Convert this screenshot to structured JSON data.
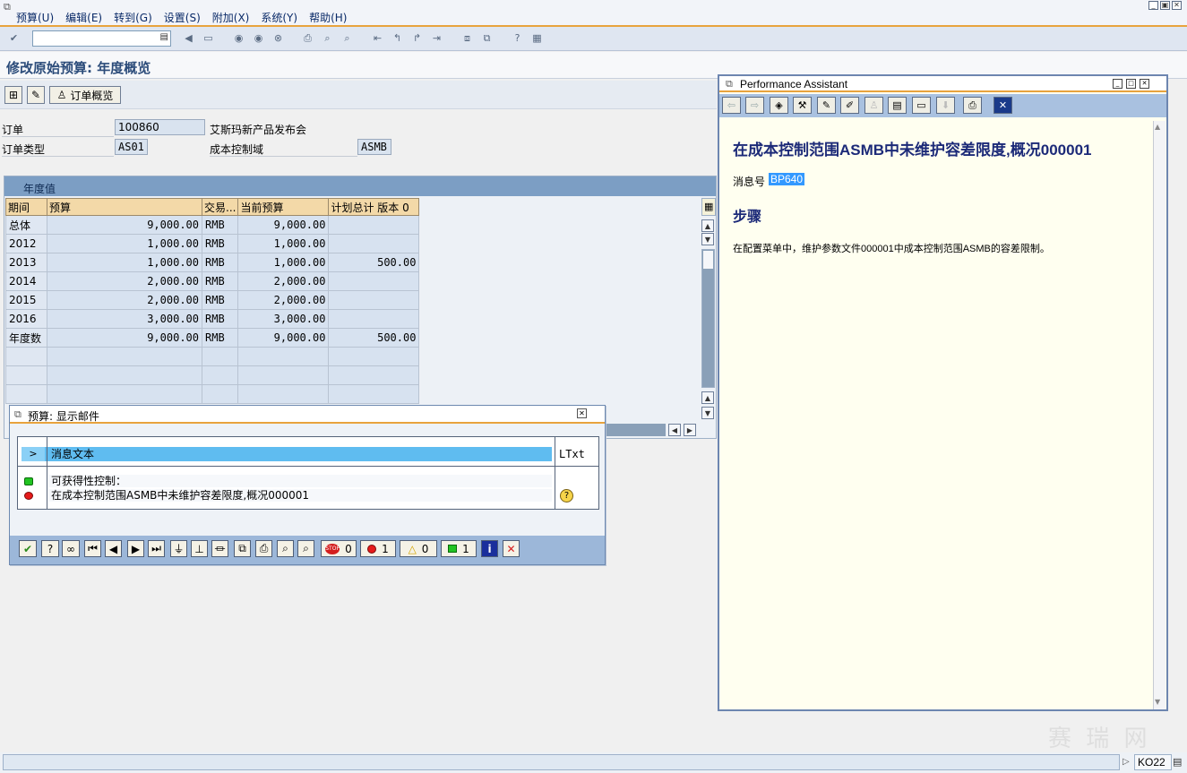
{
  "menu": {
    "items": [
      "预算(U)",
      "编辑(E)",
      "转到(G)",
      "设置(S)",
      "附加(X)",
      "系统(Y)",
      "帮助(H)"
    ]
  },
  "toolbar": {
    "command_value": "",
    "icons": [
      "enter-icon",
      "dropdown-icon",
      "back-icon",
      "save-icon",
      "back-nav-icon",
      "exit-icon",
      "cancel-icon",
      "print-icon",
      "find-icon",
      "find-next-icon",
      "first-page-icon",
      "prev-page-icon",
      "next-page-icon",
      "last-page-icon",
      "new-session-icon",
      "shortcut-icon",
      "help-icon",
      "layout-icon"
    ]
  },
  "page": {
    "title": "修改原始预算: 年度概览"
  },
  "app_toolbar": {
    "order_overview_label": "订单概览"
  },
  "header": {
    "order_label": "订单",
    "order_value": "100860",
    "order_desc": "艾斯玛新产品发布会",
    "order_type_label": "订单类型",
    "order_type_value": "AS01",
    "controlling_area_label": "成本控制域",
    "controlling_area_value": "ASMB"
  },
  "annual_table": {
    "title": "年度值",
    "columns": [
      "期间",
      "预算",
      "交易...",
      "当前预算",
      "计划总计 版本 0"
    ],
    "rows": [
      [
        "总体",
        "9,000.00",
        "RMB",
        "9,000.00",
        ""
      ],
      [
        "2012",
        "1,000.00",
        "RMB",
        "1,000.00",
        ""
      ],
      [
        "2013",
        "1,000.00",
        "RMB",
        "1,000.00",
        "500.00"
      ],
      [
        "2014",
        "2,000.00",
        "RMB",
        "2,000.00",
        ""
      ],
      [
        "2015",
        "2,000.00",
        "RMB",
        "2,000.00",
        ""
      ],
      [
        "2016",
        "3,000.00",
        "RMB",
        "3,000.00",
        ""
      ],
      [
        "年度数",
        "9,000.00",
        "RMB",
        "9,000.00",
        "500.00"
      ],
      [
        "",
        "",
        "",
        "",
        ""
      ],
      [
        "",
        "",
        "",
        "",
        ""
      ],
      [
        "",
        "",
        "",
        "",
        ""
      ]
    ]
  },
  "message_dialog": {
    "title": "预算: 显示邮件",
    "col_text": "消息文本",
    "col_ltxt": "LTxt",
    "header_marker": ">",
    "messages": [
      {
        "status": "green",
        "text": "可获得性控制："
      },
      {
        "status": "red",
        "text": "在成本控制范围ASMB中未维护容差限度,概况000001"
      }
    ],
    "counts": {
      "stop": "0",
      "error": "1",
      "warning": "0",
      "success": "1"
    },
    "colors": {
      "header": "#5fbcf0",
      "toolbar": "#9cb7d9"
    }
  },
  "performance_assistant": {
    "title": "Performance Assistant",
    "heading": "在成本控制范围ASMB中未维护容差限度,概况000001",
    "message_no_label": "消息号",
    "message_no_value": "BP640",
    "steps_heading": "步骤",
    "step_text": "在配置菜单中，维护参数文件000001中成本控制范围ASMB的容差限制。"
  },
  "status_bar": {
    "transaction": "KO22"
  },
  "watermark": "赛 瑞 网",
  "colors": {
    "accent": "#e8a33d",
    "title_text": "#2c4c7a",
    "pa_heading": "#1c2a78",
    "selection": "#3399ff"
  }
}
